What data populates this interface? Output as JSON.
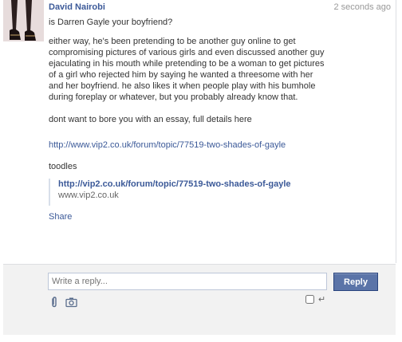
{
  "message": {
    "sender": "David Nairobi",
    "timestamp": "2 seconds ago",
    "paragraphs": [
      "is Darren Gayle your boyfriend?",
      "either way, he's been pretending to be another guy online to get compromising pictures of various girls and even discussed another guy ejaculating in his mouth while pretending to be a woman to get pictures of a girl who rejected him by saying he wanted a threesome with her and her boyfriend. he also likes it when people play with his bumhole during foreplay or whatever, but you probably already know that.",
      "dont want to bore you with an essay, full details here",
      "toodles"
    ],
    "link_url": "http://www.vip2.co.uk/forum/topic/77519-two-shades-of-gayle",
    "share_card": {
      "title": "http://vip2.co.uk/forum/topic/77519-two-shades-of-gayle",
      "domain": "www.vip2.co.uk"
    },
    "share_label": "Share"
  },
  "reply": {
    "placeholder": "Write a reply...",
    "button_label": "Reply",
    "enter_symbol": "↵"
  },
  "icons": {
    "attach": "paperclip-icon",
    "photo": "camera-icon"
  },
  "colors": {
    "link": "#3b5998",
    "reply_button": "#5b74a8",
    "timestamp": "#999999"
  }
}
